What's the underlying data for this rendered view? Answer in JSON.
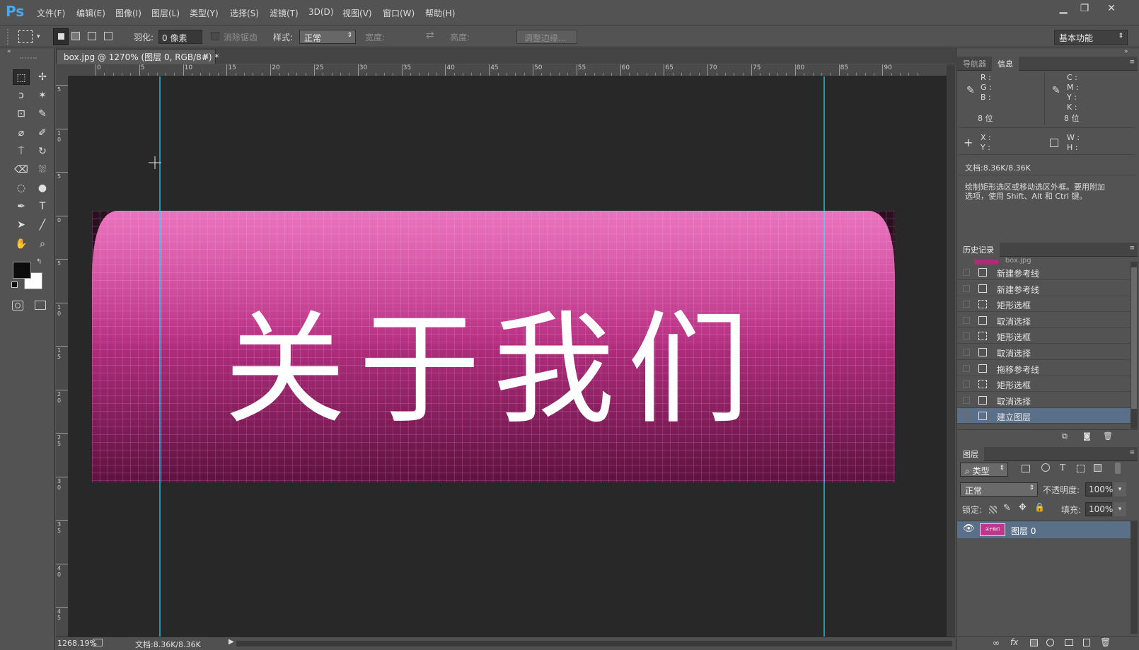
{
  "app": {
    "logo": "Ps"
  },
  "menu": [
    "文件(F)",
    "编辑(E)",
    "图像(I)",
    "图层(L)",
    "类型(Y)",
    "选择(S)",
    "滤镜(T)",
    "3D(D)",
    "视图(V)",
    "窗口(W)",
    "帮助(H)"
  ],
  "window_controls": {
    "minimize": "▁",
    "restore": "❐",
    "close": "✕"
  },
  "options": {
    "feather_label": "羽化:",
    "feather_value": "0 像素",
    "antialias_label": "消除锯齿",
    "style_label": "样式:",
    "style_value": "正常",
    "width_label": "宽度:",
    "height_label": "高度:",
    "refine_edge": "调整边缘...",
    "workspace": "基本功能"
  },
  "document": {
    "tab_title": "box.jpg @ 1270% (图层 0, RGB/8#) *",
    "close": "×",
    "ruler_h_ticks": [
      "0",
      "5",
      "10",
      "15",
      "20",
      "25",
      "30",
      "35",
      "40",
      "45",
      "50",
      "55",
      "60",
      "65",
      "70",
      "75",
      "80",
      "85",
      "90"
    ],
    "ruler_v_ticks": [
      "5",
      "10",
      "5",
      "0",
      "5",
      "10",
      "15",
      "20",
      "25",
      "30",
      "35",
      "40",
      "45"
    ],
    "image_text": "关于我们"
  },
  "status": {
    "zoom": "1268.19%",
    "doc_info": "文档:8.36K/8.36K"
  },
  "info_panel": {
    "tabs": [
      "导航器",
      "信息"
    ],
    "rgb_labels": "R :\nG :\nB :",
    "cmyk_labels": "C :\nM :\nY :\nK :",
    "bit_left": "8 位",
    "bit_right": "8 位",
    "xy_labels": "X :\nY :",
    "wh_labels": "W :\nH :",
    "doc": "文档:8.36K/8.36K",
    "hint": "绘制矩形选区或移动选区外框。要用附加\n选项，使用 Shift、Alt 和 Ctrl 键。"
  },
  "history_panel": {
    "title": "历史记录",
    "snapshot": "box.jpg",
    "items": [
      "新建参考线",
      "新建参考线",
      "矩形选框",
      "取消选择",
      "矩形选框",
      "取消选择",
      "拖移参考线",
      "矩形选框",
      "取消选择",
      "建立图层"
    ]
  },
  "layers_panel": {
    "title": "图层",
    "filter": "类型",
    "blend": "正常",
    "opacity_label": "不透明度:",
    "opacity": "100%",
    "lock_label": "锁定:",
    "fill_label": "填充:",
    "fill": "100%",
    "layer_name": "图层 0",
    "thumb_text": "关于我们"
  },
  "colors": {
    "accent_blue": "#4aa8ef",
    "guide": "#3ad6ff",
    "pink_top": "#d9489f",
    "pink_bottom": "#6d1447",
    "selected_row": "#5a7089"
  }
}
